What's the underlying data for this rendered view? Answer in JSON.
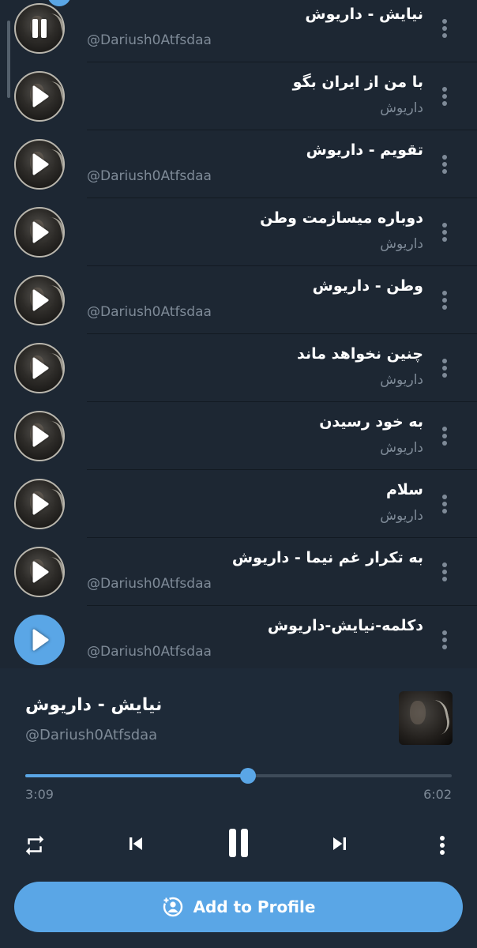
{
  "playlist": {
    "tracks": [
      {
        "title": "نیایش - داریوش",
        "subtitle": "@Dariush0Atfsdaa",
        "subtitle_dir": "ltr",
        "state": "pause",
        "cover": "art"
      },
      {
        "title": "با من از ایران بگو",
        "subtitle": "داریوش",
        "subtitle_dir": "rtl",
        "state": "play",
        "cover": "art"
      },
      {
        "title": "تقویم - داریوش",
        "subtitle": "@Dariush0Atfsdaa",
        "subtitle_dir": "ltr",
        "state": "play",
        "cover": "art"
      },
      {
        "title": "دوباره میسازمت وطن",
        "subtitle": "داریوش",
        "subtitle_dir": "rtl",
        "state": "play",
        "cover": "art"
      },
      {
        "title": "وطن - داریوش",
        "subtitle": "@Dariush0Atfsdaa",
        "subtitle_dir": "ltr",
        "state": "play",
        "cover": "art"
      },
      {
        "title": "چنین نخواهد ماند",
        "subtitle": "داریوش",
        "subtitle_dir": "rtl",
        "state": "play",
        "cover": "art"
      },
      {
        "title": "به خود رسیدن",
        "subtitle": "داریوش",
        "subtitle_dir": "rtl",
        "state": "play",
        "cover": "art"
      },
      {
        "title": "سلام",
        "subtitle": "داریوش",
        "subtitle_dir": "rtl",
        "state": "play",
        "cover": "art"
      },
      {
        "title": "به تکرار غم نیما - داریوش",
        "subtitle": "@Dariush0Atfsdaa",
        "subtitle_dir": "ltr",
        "state": "play",
        "cover": "art"
      },
      {
        "title": "دکلمه-نیایش-داریوش",
        "subtitle": "@Dariush0Atfsdaa",
        "subtitle_dir": "ltr",
        "state": "play",
        "cover": "blue"
      }
    ],
    "item_menu_icon": "more-vertical-icon"
  },
  "player": {
    "title": "نیایش - داریوش",
    "artist": "@Dariush0Atfsdaa",
    "current_time": "3:09",
    "total_time": "6:02",
    "progress": 0.522,
    "controls": {
      "repeat_icon": "repeat-icon",
      "previous_icon": "skip-previous-icon",
      "play_pause_icon": "pause-icon",
      "next_icon": "skip-next-icon",
      "more_icon": "more-vertical-icon"
    },
    "add_to_profile_label": "Add to Profile",
    "add_to_profile_icon": "add-profile-icon"
  },
  "colors": {
    "background": "#1d2733",
    "player_background": "#1e2a38",
    "accent": "#5aa6e6",
    "secondary_text": "#7e8a97"
  }
}
